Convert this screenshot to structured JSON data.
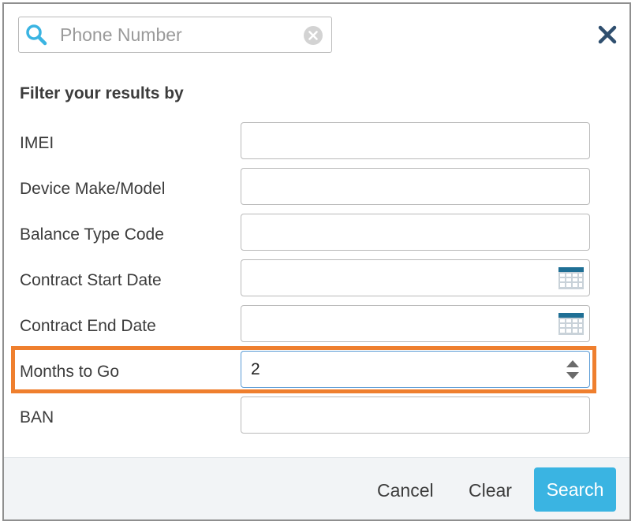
{
  "search": {
    "placeholder": "Phone Number",
    "value": ""
  },
  "filter": {
    "heading": "Filter your results by",
    "rows": [
      {
        "label": "IMEI",
        "value": ""
      },
      {
        "label": "Device Make/Model",
        "value": ""
      },
      {
        "label": "Balance Type Code",
        "value": ""
      },
      {
        "label": "Contract Start Date",
        "value": ""
      },
      {
        "label": "Contract End Date",
        "value": ""
      },
      {
        "label": "Months to Go",
        "value": "2"
      },
      {
        "label": "BAN",
        "value": ""
      }
    ]
  },
  "footer": {
    "cancel_label": "Cancel",
    "clear_label": "Clear",
    "search_label": "Search"
  },
  "colors": {
    "accent": "#3ab4e2",
    "highlight": "#ef7f2e",
    "search_icon": "#3ab4e2"
  },
  "icons": {
    "search": "magnifier-icon",
    "clear": "clear-circle-icon",
    "close": "close-icon",
    "calendar": "calendar-icon",
    "spinner": "up-down-spinner-icon"
  }
}
